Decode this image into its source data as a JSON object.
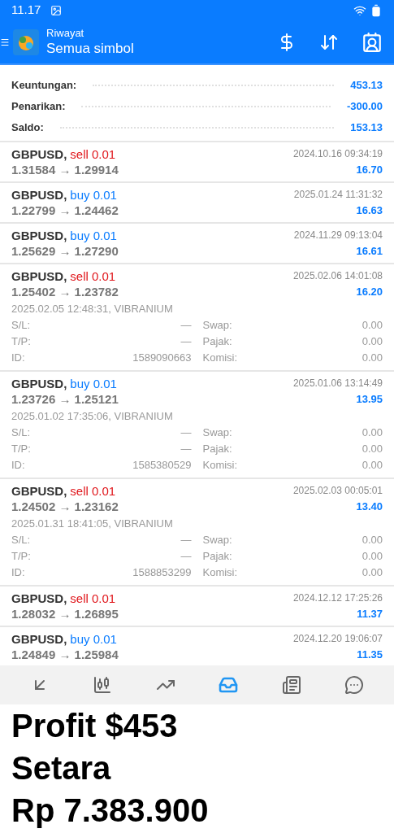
{
  "status_bar": {
    "time": "11.17"
  },
  "toolbar": {
    "subtitle": "Riwayat",
    "title": "Semua simbol"
  },
  "summary": [
    {
      "label": "Keuntungan:",
      "value": "453.13"
    },
    {
      "label": "Penarikan:",
      "value": "-300.00"
    },
    {
      "label": "Saldo:",
      "value": "153.13"
    }
  ],
  "trades": [
    {
      "symbol": "GBPUSD,",
      "kind": "sell",
      "order": "sell 0.01",
      "prices": "1.31584 → 1.29914",
      "time": "2024.10.16 09:34:19",
      "profit": "16.70"
    },
    {
      "symbol": "GBPUSD,",
      "kind": "buy",
      "order": "buy 0.01",
      "prices": "1.22799 → 1.24462",
      "time": "2025.01.24 11:31:32",
      "profit": "16.63"
    },
    {
      "symbol": "GBPUSD,",
      "kind": "buy",
      "order": "buy 0.01",
      "prices": "1.25629 → 1.27290",
      "time": "2024.11.29 09:13:04",
      "profit": "16.61"
    },
    {
      "symbol": "GBPUSD,",
      "kind": "sell",
      "order": "sell 0.01",
      "prices": "1.25402 → 1.23782",
      "time": "2025.02.06 14:01:08",
      "profit": "16.20",
      "opened": "2025.02.05 12:48:31, VIBRANIUM",
      "details": [
        {
          "label": "S/L:",
          "value": "—"
        },
        {
          "label": "Swap:",
          "value": "0.00"
        },
        {
          "label": "T/P:",
          "value": "—"
        },
        {
          "label": "Pajak:",
          "value": "0.00"
        },
        {
          "label": "ID:",
          "value": "1589090663"
        },
        {
          "label": "Komisi:",
          "value": "0.00"
        }
      ]
    },
    {
      "symbol": "GBPUSD,",
      "kind": "buy",
      "order": "buy 0.01",
      "prices": "1.23726 → 1.25121",
      "time": "2025.01.06 13:14:49",
      "profit": "13.95",
      "opened": "2025.01.02 17:35:06, VIBRANIUM",
      "details": [
        {
          "label": "S/L:",
          "value": "—"
        },
        {
          "label": "Swap:",
          "value": "0.00"
        },
        {
          "label": "T/P:",
          "value": "—"
        },
        {
          "label": "Pajak:",
          "value": "0.00"
        },
        {
          "label": "ID:",
          "value": "1585380529"
        },
        {
          "label": "Komisi:",
          "value": "0.00"
        }
      ]
    },
    {
      "symbol": "GBPUSD,",
      "kind": "sell",
      "order": "sell 0.01",
      "prices": "1.24502 → 1.23162",
      "time": "2025.02.03 00:05:01",
      "profit": "13.40",
      "opened": "2025.01.31 18:41:05, VIBRANIUM",
      "details": [
        {
          "label": "S/L:",
          "value": "—"
        },
        {
          "label": "Swap:",
          "value": "0.00"
        },
        {
          "label": "T/P:",
          "value": "—"
        },
        {
          "label": "Pajak:",
          "value": "0.00"
        },
        {
          "label": "ID:",
          "value": "1588853299"
        },
        {
          "label": "Komisi:",
          "value": "0.00"
        }
      ]
    },
    {
      "symbol": "GBPUSD,",
      "kind": "sell",
      "order": "sell 0.01",
      "prices": "1.28032 → 1.26895",
      "time": "2024.12.12 17:25:26",
      "profit": "11.37"
    },
    {
      "symbol": "GBPUSD,",
      "kind": "buy",
      "order": "buy 0.01",
      "prices": "1.24849 → 1.25984",
      "time": "2024.12.20 19:06:07",
      "profit": "11.35"
    }
  ],
  "bottom_nav": [
    {
      "kind": "quotes",
      "selected": false
    },
    {
      "kind": "chart",
      "selected": false
    },
    {
      "kind": "trade",
      "selected": false
    },
    {
      "kind": "history",
      "selected": true
    },
    {
      "kind": "news",
      "selected": false
    },
    {
      "kind": "chat",
      "selected": false
    }
  ],
  "caption": [
    "Profit $453",
    "Setara",
    "Rp 7.383.900"
  ]
}
